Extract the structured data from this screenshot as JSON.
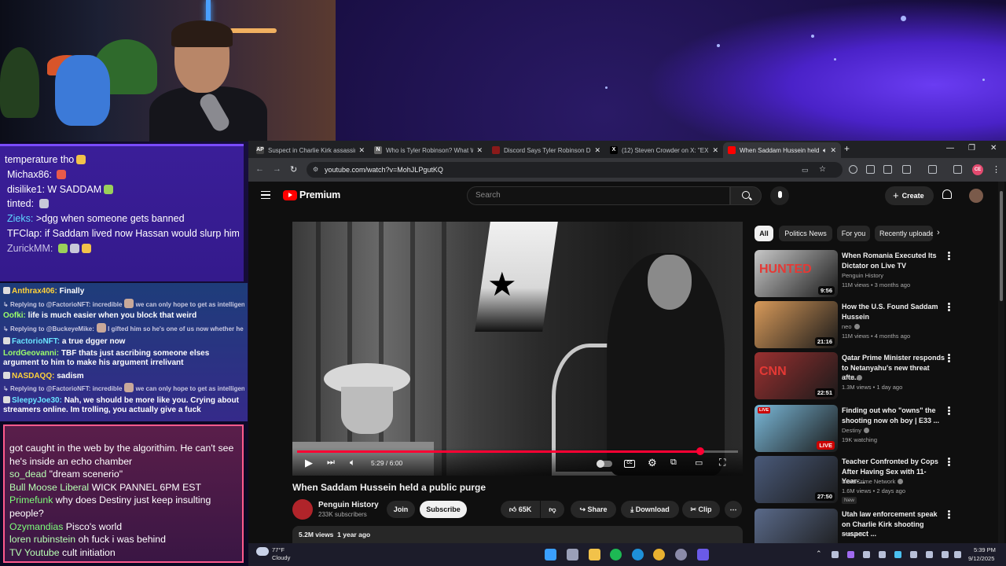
{
  "stream": {
    "chat_top": [
      {
        "user": "",
        "text": "temperature tho",
        "emotes": 1
      },
      {
        "user": "Michax86:",
        "text": "",
        "emotes": 1
      },
      {
        "user": "disilike1:",
        "text": "W SADDAM",
        "emotes": 1
      },
      {
        "user": "tinted:",
        "text": "",
        "emotes": 1
      },
      {
        "user": "Zieks:",
        "text": ">dgg when someone gets banned",
        "emotes": 0
      },
      {
        "user": "TFClap:",
        "text": "if Saddam lived now Hassan would slurp him",
        "emotes": 1
      },
      {
        "user": "ZurickMM:",
        "text": "",
        "emotes": 3
      }
    ],
    "chat_mid": [
      {
        "user": "Anthrax406:",
        "text": "Finally"
      },
      {
        "reply": "Replying to @FactorioNFT: incredible",
        "reply_tail": "we can only hope to get as intelligent"
      },
      {
        "user": "Oofki:",
        "text": "life is much easier when you block that weird"
      },
      {
        "reply": "Replying to @BuckeyeMike:",
        "reply_tail": "I gifted him so he's one of us now whether he likes it or not"
      },
      {
        "user": "FactorioNFT:",
        "text": "a true dgger now"
      },
      {
        "user": "LordGeovanni:",
        "text": "TBF thats just ascribing someone elses argument to him to make his argument irrelivant"
      },
      {
        "user": "NASDAQQ:",
        "text": "sadism"
      },
      {
        "reply": "Replying to @FactorioNFT: incredible",
        "reply_tail": "we can only hope to get as intelligent"
      },
      {
        "user": "SleepyJoe30:",
        "text": "Nah, we should be more like you. Crying about streamers online. Im trolling, you actually give a fuck"
      }
    ],
    "chat_bottom": [
      {
        "user": "",
        "text": "got caught in the web by the algorithim. He can't see he's inside an echo chamber"
      },
      {
        "user": "so_dead",
        "text": "\"dream scenerio\""
      },
      {
        "user": "Bull Moose Liberal",
        "text": "WICK PANNEL 6PM EST"
      },
      {
        "user": "Primefunk",
        "text": "why does Destiny just keep insulting people?"
      },
      {
        "user": "Ozymandias",
        "text": "Pisco's world"
      },
      {
        "user": "loren rubinstein",
        "text": "oh fuck i was behind"
      },
      {
        "user": "TV Youtube",
        "text": "cult initiation"
      }
    ]
  },
  "browser": {
    "tabs": [
      {
        "title": "Suspect in Charlie Kirk assassina",
        "favicon": "AP",
        "color": "#444444",
        "active": false
      },
      {
        "title": "Who is Tyler Robinson? What W",
        "favicon": "N",
        "color": "#666666",
        "active": false
      },
      {
        "title": "Discord Says Tyler Robinson Dis",
        "favicon": "",
        "color": "#8a1a1a",
        "active": false
      },
      {
        "title": "(12) Steven Crowder on X: \"EXC",
        "favicon": "X",
        "color": "#000000",
        "active": false
      },
      {
        "title": "When Saddam Hussein held",
        "favicon": "",
        "color": "#ff0000",
        "active": true
      }
    ],
    "new_tab_label": "+",
    "url": "youtube.com/watch?v=MohJLPgutKQ"
  },
  "youtube": {
    "logo_text": "Premium",
    "search_placeholder": "Search",
    "create_label": "Create",
    "player": {
      "current_time": "5:29",
      "duration": "6:00",
      "progress_fraction": 0.914
    },
    "video": {
      "title": "When Saddam Hussein held a public purge",
      "channel": "Penguin History",
      "subscribers": "233K subscribers",
      "join_label": "Join",
      "subscribe_label": "Subscribe",
      "likes": "65K",
      "share_label": "Share",
      "download_label": "Download",
      "clip_label": "Clip",
      "views": "5.2M views",
      "age": "1 year ago"
    },
    "chips": [
      "All",
      "Politics News",
      "For you",
      "Recently uploaded"
    ],
    "recommendations": [
      {
        "title": "When Romania Executed Its Dictator on Live TV",
        "channel": "Penguin History",
        "verified": false,
        "views": "11M views",
        "age": "3 months ago",
        "duration": "9:56",
        "live": false,
        "new": false,
        "thumb_text": "HUNTED",
        "thumb_color": "#c8c8c8"
      },
      {
        "title": "How the U.S. Found Saddam Hussein",
        "channel": "neo",
        "verified": true,
        "views": "11M views",
        "age": "4 months ago",
        "duration": "21:16",
        "live": false,
        "new": false,
        "thumb_text": "",
        "thumb_color": "#d89a5a"
      },
      {
        "title": "Qatar Prime Minister responds to Netanyahu's new threat afte...",
        "channel": "CNN",
        "verified": true,
        "views": "1.3M views",
        "age": "1 day ago",
        "duration": "22:51",
        "live": false,
        "new": false,
        "thumb_text": "CNN",
        "thumb_color": "#9a3030"
      },
      {
        "title": "Finding out who \"owns\" the shooting now oh boy | E33 ...",
        "channel": "Destiny",
        "verified": true,
        "views": "19K watching",
        "age": "",
        "duration": "LIVE",
        "live": true,
        "new": false,
        "thumb_text": "",
        "thumb_color": "#7ab8d8"
      },
      {
        "title": "Teacher Confronted by Cops After Having Sex with 11-Year-...",
        "channel": "Law&Crime Network",
        "verified": true,
        "views": "1.6M views",
        "age": "2 days ago",
        "duration": "27:50",
        "live": false,
        "new": true,
        "thumb_text": "",
        "thumb_color": "#4a5a7a"
      },
      {
        "title": "Utah law enforcement speak on Charlie Kirk shooting suspect ...",
        "channel": "Denver7",
        "verified": false,
        "views": "",
        "age": "",
        "duration": "",
        "live": false,
        "new": false,
        "thumb_text": "",
        "thumb_color": "#5a6a8a"
      }
    ],
    "new_label": "New"
  },
  "taskbar": {
    "temperature": "77°F",
    "condition": "Cloudy",
    "time": "5:39 PM",
    "date": "9/12/2025"
  }
}
